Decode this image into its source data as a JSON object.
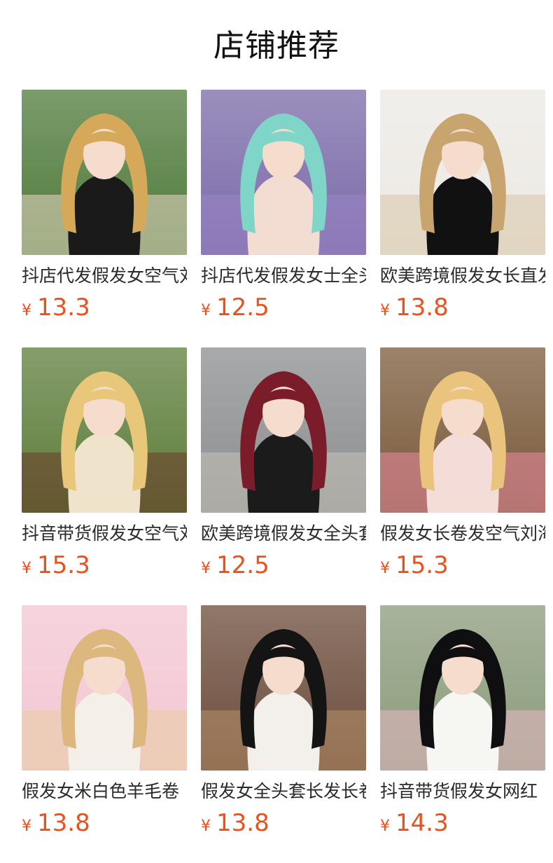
{
  "header": {
    "title": "店铺推荐"
  },
  "currency_symbol": "¥",
  "products": [
    {
      "name": "抖店代发假发女空气刘海",
      "price": "13.3",
      "image": "blonde-curly-wig-garden",
      "colors": {
        "bg": "#4f7a3a",
        "hair": "#d6a95a",
        "outfit": "#1a1a1a",
        "accent": "#e9d9c7"
      }
    },
    {
      "name": "抖店代发假发女士全头套",
      "price": "12.5",
      "image": "mint-long-wig-wisteria",
      "colors": {
        "bg": "#7a6aa8",
        "hair": "#7fd6c8",
        "outfit": "#f3ddd3",
        "accent": "#9b86c6"
      }
    },
    {
      "name": "欧美跨境假发女长直发",
      "price": "13.8",
      "image": "blonde-straight-wig-kitchen",
      "colors": {
        "bg": "#ece9e4",
        "hair": "#c8a56e",
        "outfit": "#111111",
        "accent": "#d8c6a8"
      }
    },
    {
      "name": "抖音带货假发女空气刘海",
      "price": "15.3",
      "image": "blonde-pink-wig-bench",
      "colors": {
        "bg": "#5d7d3a",
        "hair": "#e9c77a",
        "outfit": "#efe3cb",
        "accent": "#6b3a2a"
      }
    },
    {
      "name": "欧美跨境假发女全头套",
      "price": "12.5",
      "image": "burgundy-wig-street",
      "colors": {
        "bg": "#8b8d8f",
        "hair": "#7a1c2a",
        "outfit": "#1b1b1b",
        "accent": "#c9c3b8"
      }
    },
    {
      "name": "假发女长卷发空气刘海",
      "price": "15.3",
      "image": "blonde-pink-wig-florist",
      "colors": {
        "bg": "#7a5a3a",
        "hair": "#eac47c",
        "outfit": "#f4dcd9",
        "accent": "#e98aa0"
      }
    },
    {
      "name": "假发女米白色羊毛卷",
      "price": "13.8",
      "image": "beige-curly-wig-toystore",
      "colors": {
        "bg": "#f3c6d3",
        "hair": "#dcb77e",
        "outfit": "#f4efe8",
        "accent": "#e8cfa3"
      }
    },
    {
      "name": "假发女全头套长发长卷",
      "price": "13.8",
      "image": "black-curly-wig-dollshop",
      "colors": {
        "bg": "#6b4b3a",
        "hair": "#141414",
        "outfit": "#f3f0ec",
        "accent": "#b8916a"
      }
    },
    {
      "name": "抖音带货假发女网红",
      "price": "14.3",
      "image": "black-wig-flowers",
      "colors": {
        "bg": "#8a9a7a",
        "hair": "#0f0f12",
        "outfit": "#f6f6f2",
        "accent": "#e9b9c4"
      }
    }
  ]
}
